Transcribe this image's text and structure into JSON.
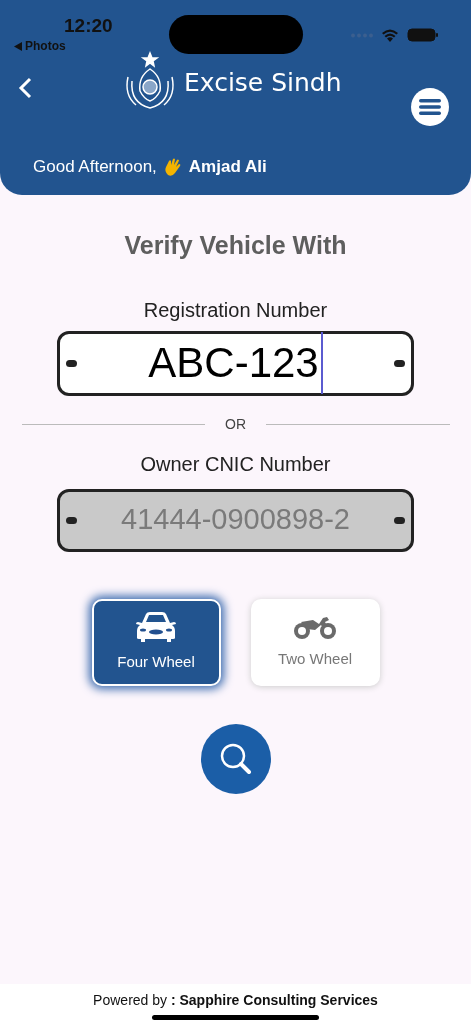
{
  "status_bar": {
    "time": "12:20",
    "back_app": "Photos"
  },
  "header": {
    "title": "Excise Sindh",
    "greeting": "Good Afternoon,",
    "user_name": "Amjad Ali"
  },
  "form": {
    "heading": "Verify Vehicle With",
    "registration": {
      "label": "Registration Number",
      "value": "ABC-123",
      "focused": true
    },
    "separator": "OR",
    "cnic": {
      "label": "Owner CNIC Number",
      "placeholder": "41444-0900898-2"
    },
    "vehicle_types": [
      {
        "kind": "car",
        "label": "Four Wheel",
        "selected": true
      },
      {
        "kind": "motorcycle",
        "label": "Two Wheel",
        "selected": false
      }
    ]
  },
  "footer": {
    "text": "Powered by **: Sapphire Consulting Services**"
  }
}
